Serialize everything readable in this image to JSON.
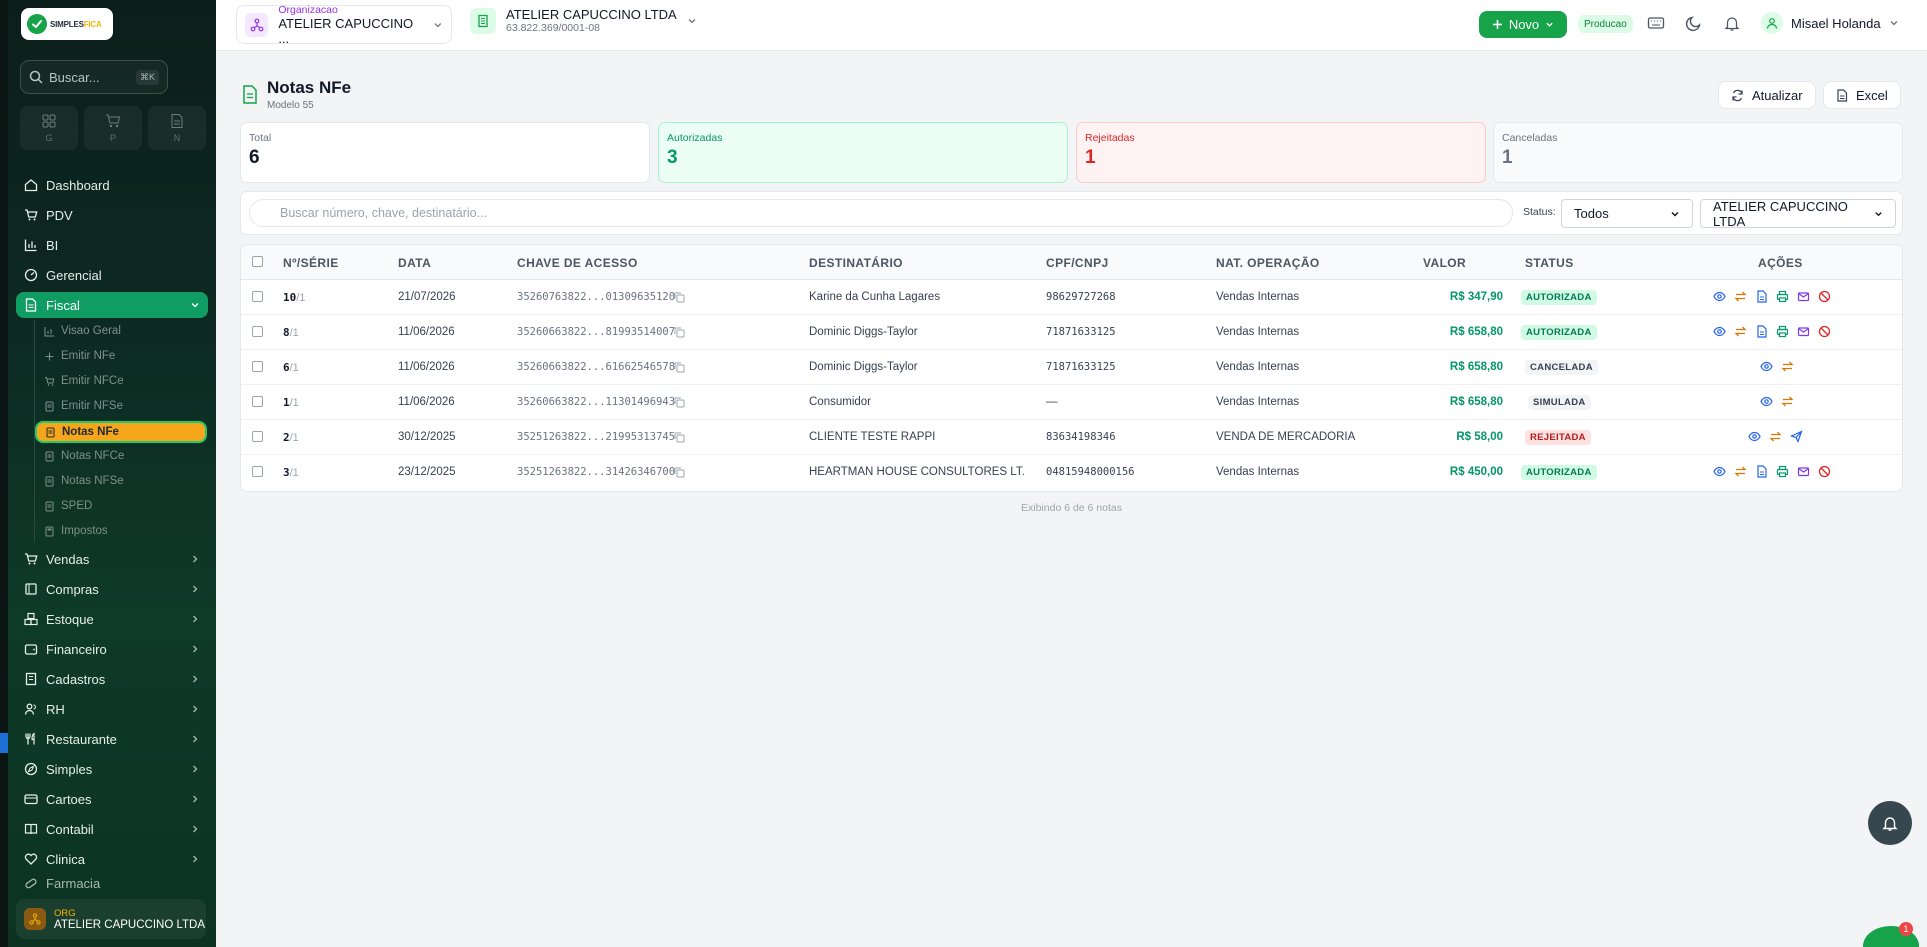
{
  "brand": {
    "logo_text": "SIMPLESFICA",
    "logo_text_a": "SIMPLES",
    "logo_text_b": "FICA"
  },
  "colors": {
    "primary": "#16a34a",
    "sidebar_bg": "#0e2a22",
    "active_sub": "#f6a61a",
    "danger": "#dc2626"
  },
  "sidebar": {
    "search_placeholder": "Buscar...",
    "search_shortcut": "⌘K",
    "quick": [
      {
        "label": "G",
        "icon": "grid-icon"
      },
      {
        "label": "P",
        "icon": "cart-icon"
      },
      {
        "label": "N",
        "icon": "file-icon"
      }
    ],
    "nav": [
      {
        "label": "Dashboard",
        "icon": "home-icon"
      },
      {
        "label": "PDV",
        "icon": "cart-icon"
      },
      {
        "label": "BI",
        "icon": "bar-chart-icon"
      },
      {
        "label": "Gerencial",
        "icon": "gauge-icon"
      },
      {
        "label": "Fiscal",
        "icon": "file-icon"
      }
    ],
    "fiscal_sub": [
      {
        "label": "Visao Geral",
        "icon": "chart-icon"
      },
      {
        "label": "Emitir NFe",
        "icon": "plus-icon"
      },
      {
        "label": "Emitir NFCe",
        "icon": "cart-icon"
      },
      {
        "label": "Emitir NFSe",
        "icon": "doc-icon"
      },
      {
        "label": "Notas NFe",
        "icon": "doc-icon"
      },
      {
        "label": "Notas NFCe",
        "icon": "doc-icon"
      },
      {
        "label": "Notas NFSe",
        "icon": "doc-icon"
      },
      {
        "label": "SPED",
        "icon": "doc-icon"
      },
      {
        "label": "Impostos",
        "icon": "calc-icon"
      }
    ],
    "nav_bottom": [
      {
        "label": "Vendas",
        "icon": "cart-icon"
      },
      {
        "label": "Compras",
        "icon": "box-icon"
      },
      {
        "label": "Estoque",
        "icon": "boxes-icon"
      },
      {
        "label": "Financeiro",
        "icon": "wallet-icon"
      },
      {
        "label": "Cadastros",
        "icon": "building-icon"
      },
      {
        "label": "RH",
        "icon": "users-icon"
      },
      {
        "label": "Restaurante",
        "icon": "utensils-icon"
      },
      {
        "label": "Simples",
        "icon": "compass-icon"
      },
      {
        "label": "Cartoes",
        "icon": "card-icon"
      },
      {
        "label": "Contabil",
        "icon": "book-icon"
      },
      {
        "label": "Clinica",
        "icon": "heart-icon"
      },
      {
        "label": "Farmacia",
        "icon": "pill-icon"
      }
    ],
    "org_label": "ORG",
    "org_name": "ATELIER CAPUCCINO LTDA"
  },
  "topbar": {
    "org_label": "Organizacao",
    "org_name": "ATELIER CAPUCCINO ...",
    "company_name": "ATELIER CAPUCCINO LTDA",
    "company_cnpj": "63.822.369/0001-08",
    "new_label": "Novo",
    "env_badge": "Producao",
    "user_name": "Misael Holanda"
  },
  "page": {
    "title": "Notas NFe",
    "subtitle": "Modelo 55",
    "refresh_label": "Atualizar",
    "excel_label": "Excel"
  },
  "stats": [
    {
      "label": "Total",
      "value": "6"
    },
    {
      "label": "Autorizadas",
      "value": "3"
    },
    {
      "label": "Rejeitadas",
      "value": "1"
    },
    {
      "label": "Canceladas",
      "value": "1"
    }
  ],
  "filters": {
    "search_placeholder": "Buscar número, chave, destinatário...",
    "status_label": "Status:",
    "status_value": "Todos",
    "company_value": "ATELIER CAPUCCINO LTDA"
  },
  "table": {
    "columns": [
      "Nº/SÉRIE",
      "DATA",
      "CHAVE DE ACESSO",
      "DESTINATÁRIO",
      "CPF/CNPJ",
      "NAT. OPERAÇÃO",
      "VALOR",
      "STATUS",
      "AÇÕES"
    ],
    "rows": [
      {
        "num": "10",
        "serie": "/1",
        "date": "21/07/2026",
        "key": "35260763822...01309635120",
        "dest": "Karine da Cunha Lagares",
        "doc": "98629727268",
        "nat": "Vendas Internas",
        "value": "R$ 347,90",
        "status": "AUTORIZADA",
        "kind": "aut"
      },
      {
        "num": "8",
        "serie": "/1",
        "date": "11/06/2026",
        "key": "35260663822...81993514007",
        "dest": "Dominic Diggs-Taylor",
        "doc": "71871633125",
        "nat": "Vendas Internas",
        "value": "R$ 658,80",
        "status": "AUTORIZADA",
        "kind": "aut"
      },
      {
        "num": "6",
        "serie": "/1",
        "date": "11/06/2026",
        "key": "35260663822...61662546578",
        "dest": "Dominic Diggs-Taylor",
        "doc": "71871633125",
        "nat": "Vendas Internas",
        "value": "R$ 658,80",
        "status": "CANCELADA",
        "kind": "can"
      },
      {
        "num": "1",
        "serie": "/1",
        "date": "11/06/2026",
        "key": "35260663822...11301496943",
        "dest": "Consumidor",
        "doc": "—",
        "nat": "Vendas Internas",
        "value": "R$ 658,80",
        "status": "SIMULADA",
        "kind": "sim"
      },
      {
        "num": "2",
        "serie": "/1",
        "date": "30/12/2025",
        "key": "35251263822...21995313745",
        "dest": "CLIENTE TESTE RAPPI",
        "doc": "83634198346",
        "nat": "VENDA DE MERCADORIA",
        "value": "R$ 58,00",
        "status": "REJEITADA",
        "kind": "rej"
      },
      {
        "num": "3",
        "serie": "/1",
        "date": "23/12/2025",
        "key": "35251263822...31426346700",
        "dest": "HEARTMAN HOUSE CONSULTORES LT...",
        "doc": "04815948000156",
        "nat": "Vendas Internas",
        "value": "R$ 450,00",
        "status": "AUTORIZADA",
        "kind": "aut"
      }
    ],
    "footer": "Exibindo 6 de 6 notas"
  },
  "chat_badge": "1"
}
